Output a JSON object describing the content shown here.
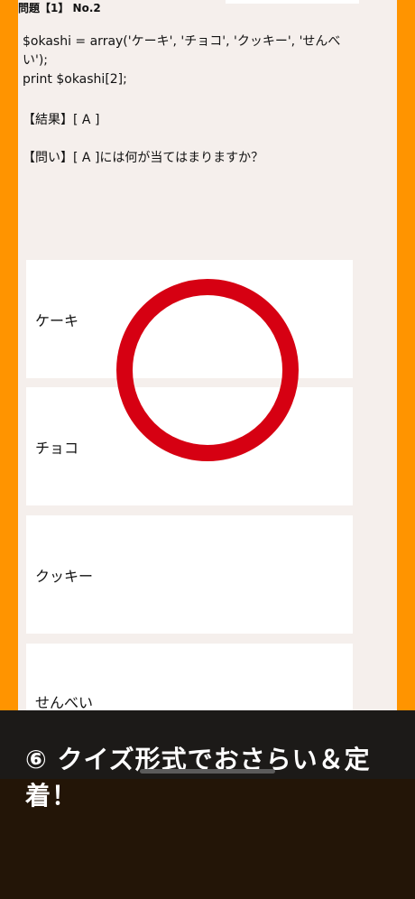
{
  "header": {
    "question_label": "問題【1】 No.2"
  },
  "code": {
    "line1": "$okashi = array('ケーキ', 'チョコ', 'クッキー', 'せんべい');",
    "line2": "print $okashi[2];"
  },
  "result": {
    "text": "【結果】[ A ]"
  },
  "question": {
    "text": "【問い】[ A ]には何が当てはまりますか？"
  },
  "options": [
    {
      "label": "ケーキ"
    },
    {
      "label": "チョコ"
    },
    {
      "label": "クッキー"
    },
    {
      "label": "せんべい"
    }
  ],
  "caption": {
    "text": "⑥ クイズ形式でおさらい＆定着！"
  },
  "colors": {
    "frame": "#ff9400",
    "panel": "#f5efec",
    "mark": "#d60012",
    "caption_bg": "#231507"
  },
  "icons": {
    "correct_mark": "circle-icon"
  }
}
